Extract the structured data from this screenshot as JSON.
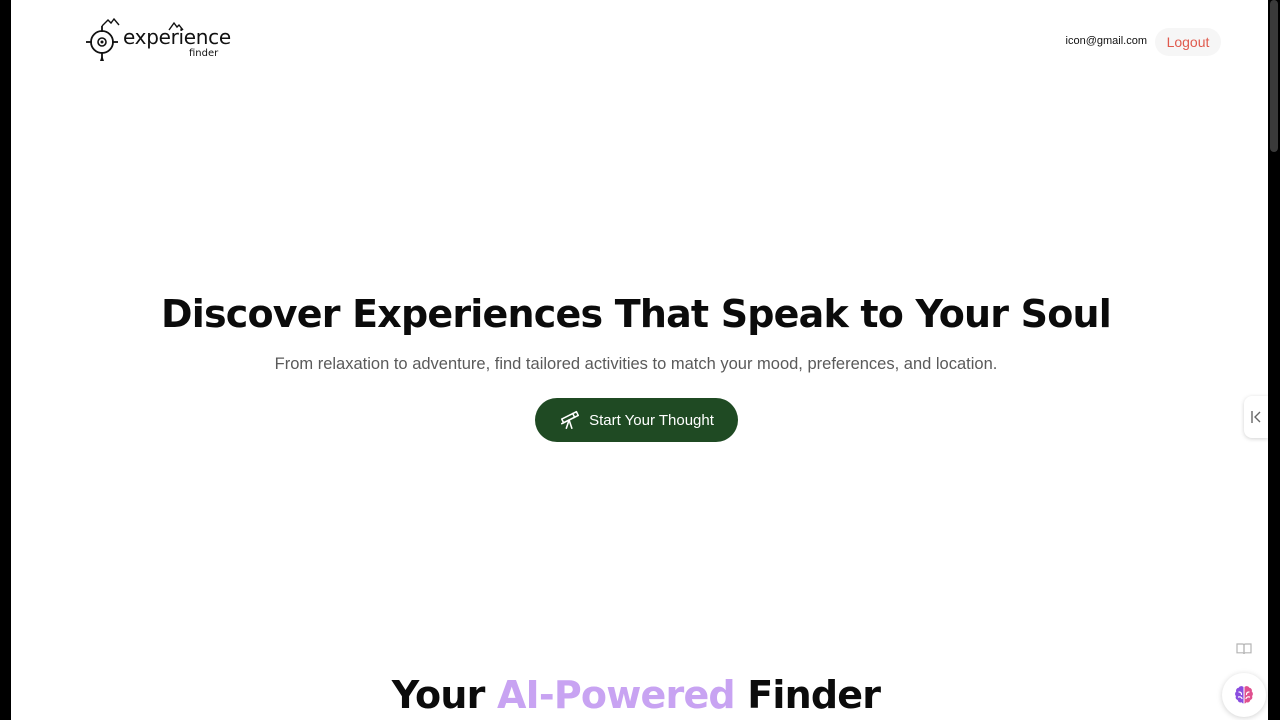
{
  "header": {
    "logo_word": "experience",
    "logo_sub": "finder",
    "user_email": "icon@gmail.com",
    "logout_label": "Logout"
  },
  "hero": {
    "title": "Discover Experiences That Speak to Your Soul",
    "subtitle": "From relaxation to adventure, find tailored activities to match your mood, preferences, and location.",
    "cta_label": "Start Your Thought",
    "cta_icon": "telescope-icon"
  },
  "section": {
    "title_part1": "Your ",
    "title_accent": "AI-Powered",
    "title_part2": " Finder"
  },
  "widgets": {
    "side_tab_icon": "collapse-icon",
    "book_icon": "book-icon",
    "assistant_icon": "brain-icon"
  },
  "colors": {
    "brand_green": "#1f4a23",
    "logout_red": "#e05a4d",
    "accent_purple": "#c8a3f2"
  }
}
